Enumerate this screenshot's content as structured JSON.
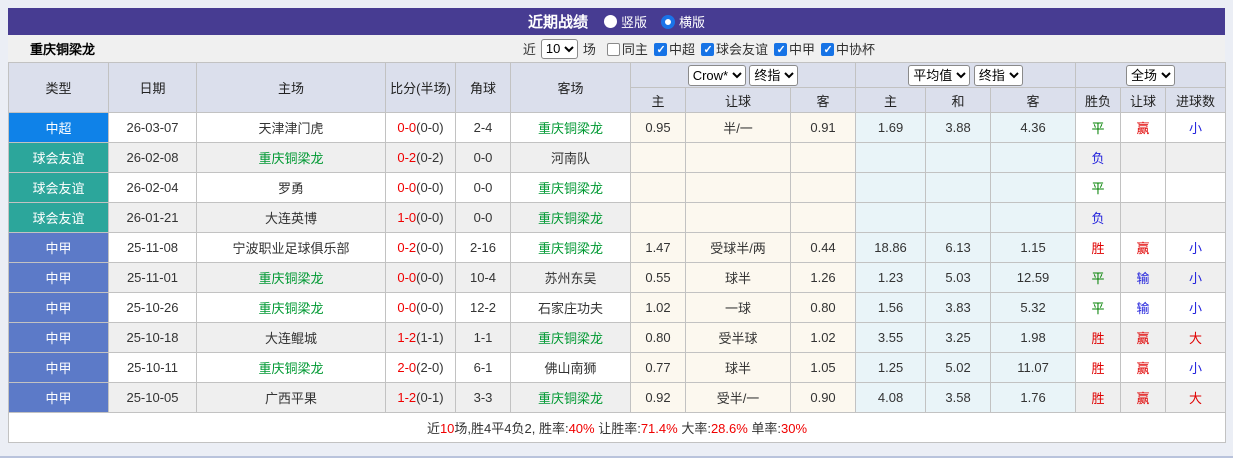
{
  "title_bar": {
    "title": "近期战绩",
    "radios": [
      {
        "label": "竖版",
        "checked": false
      },
      {
        "label": "横版",
        "checked": true
      }
    ]
  },
  "filter_bar": {
    "team_name": "重庆铜梁龙",
    "recent_label": "近",
    "recent_value": "10",
    "matches_label": "场",
    "same_home": {
      "label": "同主",
      "checked": false
    },
    "league_filters": [
      {
        "label": "中超",
        "checked": true
      },
      {
        "label": "球会友谊",
        "checked": true
      },
      {
        "label": "中甲",
        "checked": true
      },
      {
        "label": "中协杯",
        "checked": true
      }
    ]
  },
  "table": {
    "selects": {
      "company": "Crow*",
      "company_time": "终指",
      "average": "平均值",
      "average_time": "终指",
      "scope": "全场"
    },
    "columns": [
      "类型",
      "日期",
      "主场",
      "比分(半场)",
      "角球",
      "客场",
      "主",
      "让球",
      "客",
      "主",
      "和",
      "客",
      "胜负",
      "让球",
      "进球数"
    ],
    "league_colors": {
      "中超": "#0f82e8",
      "球会友谊": "#2ca69b",
      "中甲": "#5c7ac8"
    },
    "result_colors": {
      "胜": "#e00000",
      "平": "#008000",
      "负": "#2323dd",
      "赢": "#e00000",
      "输": "#2323dd",
      "大": "#e00000",
      "小": "#2323dd"
    },
    "rows": [
      {
        "league": "中超",
        "date": "26-03-07",
        "home": "天津津门虎",
        "home_main": false,
        "score": "0-0",
        "half": "(0-0)",
        "corner": "2-4",
        "away": "重庆铜梁龙",
        "away_main": true,
        "crow_home": "0.95",
        "crow_line": "半/一",
        "crow_away": "0.91",
        "avg_home": "1.69",
        "avg_draw": "3.88",
        "avg_away": "4.36",
        "result": "平",
        "handicap": "赢",
        "goals": "小"
      },
      {
        "league": "球会友谊",
        "date": "26-02-08",
        "home": "重庆铜梁龙",
        "home_main": true,
        "score": "0-2",
        "half": "(0-2)",
        "corner": "0-0",
        "away": "河南队",
        "away_main": false,
        "crow_home": "",
        "crow_line": "",
        "crow_away": "",
        "avg_home": "",
        "avg_draw": "",
        "avg_away": "",
        "result": "负",
        "handicap": "",
        "goals": ""
      },
      {
        "league": "球会友谊",
        "date": "26-02-04",
        "home": "罗勇",
        "home_main": false,
        "score": "0-0",
        "half": "(0-0)",
        "corner": "0-0",
        "away": "重庆铜梁龙",
        "away_main": true,
        "crow_home": "",
        "crow_line": "",
        "crow_away": "",
        "avg_home": "",
        "avg_draw": "",
        "avg_away": "",
        "result": "平",
        "handicap": "",
        "goals": ""
      },
      {
        "league": "球会友谊",
        "date": "26-01-21",
        "home": "大连英博",
        "home_main": false,
        "score": "1-0",
        "half": "(0-0)",
        "corner": "0-0",
        "away": "重庆铜梁龙",
        "away_main": true,
        "crow_home": "",
        "crow_line": "",
        "crow_away": "",
        "avg_home": "",
        "avg_draw": "",
        "avg_away": "",
        "result": "负",
        "handicap": "",
        "goals": ""
      },
      {
        "league": "中甲",
        "date": "25-11-08",
        "home": "宁波职业足球俱乐部",
        "home_main": false,
        "score": "0-2",
        "half": "(0-0)",
        "corner": "2-16",
        "away": "重庆铜梁龙",
        "away_main": true,
        "crow_home": "1.47",
        "crow_line": "受球半/两",
        "crow_away": "0.44",
        "avg_home": "18.86",
        "avg_draw": "6.13",
        "avg_away": "1.15",
        "result": "胜",
        "handicap": "赢",
        "goals": "小"
      },
      {
        "league": "中甲",
        "date": "25-11-01",
        "home": "重庆铜梁龙",
        "home_main": true,
        "score": "0-0",
        "half": "(0-0)",
        "corner": "10-4",
        "away": "苏州东吴",
        "away_main": false,
        "crow_home": "0.55",
        "crow_line": "球半",
        "crow_away": "1.26",
        "avg_home": "1.23",
        "avg_draw": "5.03",
        "avg_away": "12.59",
        "result": "平",
        "handicap": "输",
        "goals": "小"
      },
      {
        "league": "中甲",
        "date": "25-10-26",
        "home": "重庆铜梁龙",
        "home_main": true,
        "score": "0-0",
        "half": "(0-0)",
        "corner": "12-2",
        "away": "石家庄功夫",
        "away_main": false,
        "crow_home": "1.02",
        "crow_line": "一球",
        "crow_away": "0.80",
        "avg_home": "1.56",
        "avg_draw": "3.83",
        "avg_away": "5.32",
        "result": "平",
        "handicap": "输",
        "goals": "小"
      },
      {
        "league": "中甲",
        "date": "25-10-18",
        "home": "大连鲲城",
        "home_main": false,
        "score": "1-2",
        "half": "(1-1)",
        "corner": "1-1",
        "away": "重庆铜梁龙",
        "away_main": true,
        "crow_home": "0.80",
        "crow_line": "受半球",
        "crow_away": "1.02",
        "avg_home": "3.55",
        "avg_draw": "3.25",
        "avg_away": "1.98",
        "result": "胜",
        "handicap": "赢",
        "goals": "大"
      },
      {
        "league": "中甲",
        "date": "25-10-11",
        "home": "重庆铜梁龙",
        "home_main": true,
        "score": "2-0",
        "half": "(2-0)",
        "corner": "6-1",
        "away": "佛山南狮",
        "away_main": false,
        "crow_home": "0.77",
        "crow_line": "球半",
        "crow_away": "1.05",
        "avg_home": "1.25",
        "avg_draw": "5.02",
        "avg_away": "11.07",
        "result": "胜",
        "handicap": "赢",
        "goals": "小"
      },
      {
        "league": "中甲",
        "date": "25-10-05",
        "home": "广西平果",
        "home_main": false,
        "score": "1-2",
        "half": "(0-1)",
        "corner": "3-3",
        "away": "重庆铜梁龙",
        "away_main": true,
        "crow_home": "0.92",
        "crow_line": "受半/一",
        "crow_away": "0.90",
        "avg_home": "4.08",
        "avg_draw": "3.58",
        "avg_away": "1.76",
        "result": "胜",
        "handicap": "赢",
        "goals": "大"
      }
    ]
  },
  "summary": {
    "parts": [
      {
        "text": "近",
        "red": false
      },
      {
        "text": "10",
        "red": true
      },
      {
        "text": "场,胜4平4负2, 胜率:",
        "red": false
      },
      {
        "text": "40%",
        "red": true
      },
      {
        "text": " 让胜率:",
        "red": false
      },
      {
        "text": "71.4%",
        "red": true
      },
      {
        "text": " 大率:",
        "red": false
      },
      {
        "text": "28.6%",
        "red": true
      },
      {
        "text": " 单率:",
        "red": false
      },
      {
        "text": "30%",
        "red": true
      }
    ]
  },
  "colors": {
    "title_bar": "#473c92",
    "header_bg": "#dbdfec",
    "row_alt": "#efefef",
    "odds_col_bg": "#fcf8ef",
    "avg_col_bg": "#e9f4f8",
    "main_team_green": "#009933",
    "score_red": "#f00000",
    "accent_blue": "#1a73e8"
  }
}
